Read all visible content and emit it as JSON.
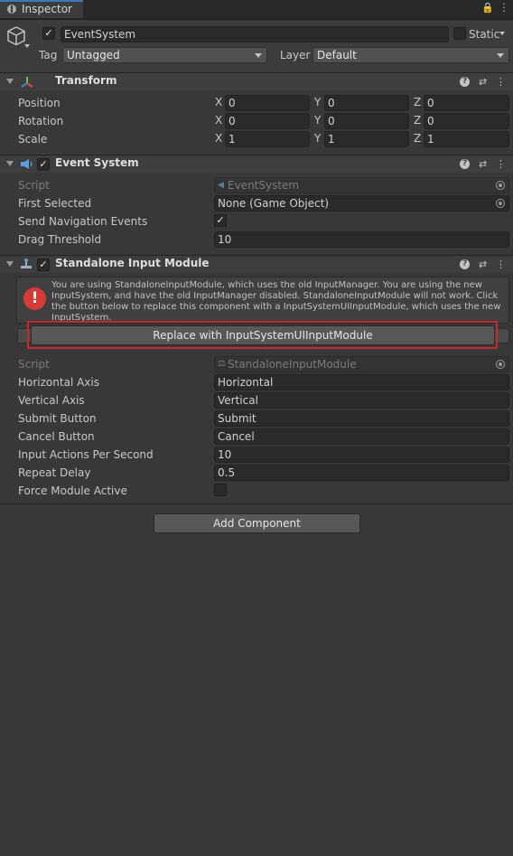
{
  "window": {
    "tab_label": "Inspector"
  },
  "object": {
    "name": "EventSystem",
    "static_label": "Static",
    "tag_label": "Tag",
    "tag_value": "Untagged",
    "layer_label": "Layer",
    "layer_value": "Default"
  },
  "transform": {
    "title": "Transform",
    "rows": [
      {
        "label": "Position",
        "x": "0",
        "y": "0",
        "z": "0"
      },
      {
        "label": "Rotation",
        "x": "0",
        "y": "0",
        "z": "0"
      },
      {
        "label": "Scale",
        "x": "1",
        "y": "1",
        "z": "1"
      }
    ],
    "axis_labels": [
      "X",
      "Y",
      "Z"
    ]
  },
  "event_system": {
    "title": "Event System",
    "script_label": "Script",
    "script_value": "EventSystem",
    "first_selected_label": "First Selected",
    "first_selected_value": "None (Game Object)",
    "send_nav_label": "Send Navigation Events",
    "send_nav_checked": true,
    "drag_threshold_label": "Drag Threshold",
    "drag_threshold_value": "10"
  },
  "standalone": {
    "title": "Standalone Input Module",
    "warning": "You are using StandaloneInputModule, which uses the old InputManager. You are using the new InputSystem, and have the old InputManager disabled. StandaloneInputModule will not work. Click the button below to replace this component with a InputSystemUIInputModule, which uses the new InputSystem.",
    "replace_button": "Replace with InputSystemUIInputModule",
    "script_label": "Script",
    "script_value": "StandaloneInputModule",
    "fields": [
      {
        "label": "Horizontal Axis",
        "value": "Horizontal"
      },
      {
        "label": "Vertical Axis",
        "value": "Vertical"
      },
      {
        "label": "Submit Button",
        "value": "Submit"
      },
      {
        "label": "Cancel Button",
        "value": "Cancel"
      },
      {
        "label": "Input Actions Per Second",
        "value": "10"
      },
      {
        "label": "Repeat Delay",
        "value": "0.5"
      }
    ],
    "force_module_label": "Force Module Active",
    "force_module_checked": false
  },
  "add_component": "Add Component",
  "colors": {
    "accent": "#3a79bb",
    "highlight_border": "#c8282a",
    "warning_icon": "#d63b36"
  }
}
